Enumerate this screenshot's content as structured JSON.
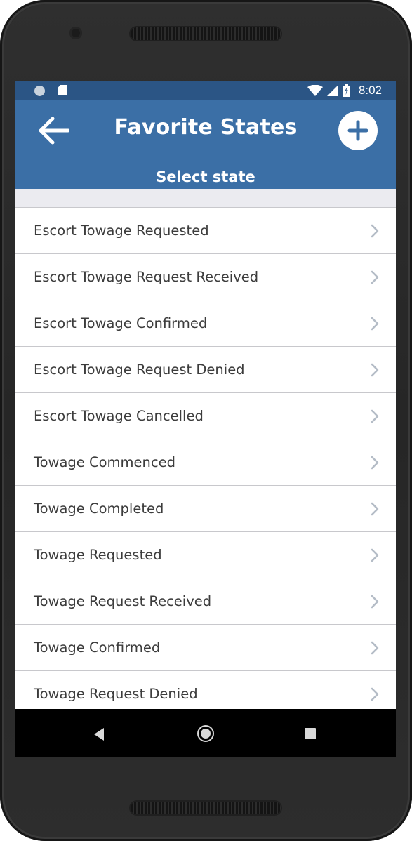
{
  "status_bar": {
    "time": "8:02",
    "icons": [
      "notification-circle-icon",
      "sd-card-icon",
      "wifi-icon",
      "cell-signal-icon",
      "battery-charging-icon"
    ]
  },
  "app_bar": {
    "title": "Favorite States",
    "subtitle": "Select state",
    "back_icon": "arrow-left-icon",
    "add_icon": "plus-circle-icon"
  },
  "states": [
    {
      "label": "Escort Towage Requested"
    },
    {
      "label": "Escort Towage Request Received"
    },
    {
      "label": "Escort Towage Confirmed"
    },
    {
      "label": "Escort Towage Request Denied"
    },
    {
      "label": "Escort Towage Cancelled"
    },
    {
      "label": "Towage Commenced"
    },
    {
      "label": "Towage Completed"
    },
    {
      "label": "Towage Requested"
    },
    {
      "label": "Towage Request Received"
    },
    {
      "label": "Towage Confirmed"
    },
    {
      "label": "Towage Request Denied"
    }
  ],
  "nav_bar": {
    "icons": [
      "nav-back-icon",
      "nav-home-icon",
      "nav-recents-icon"
    ]
  },
  "colors": {
    "status_bar": "#2b5585",
    "app_bar": "#3b6fa6",
    "list_text": "#3c3c3c",
    "chevron": "#b4bcc6",
    "divider": "#c8c8cc"
  }
}
